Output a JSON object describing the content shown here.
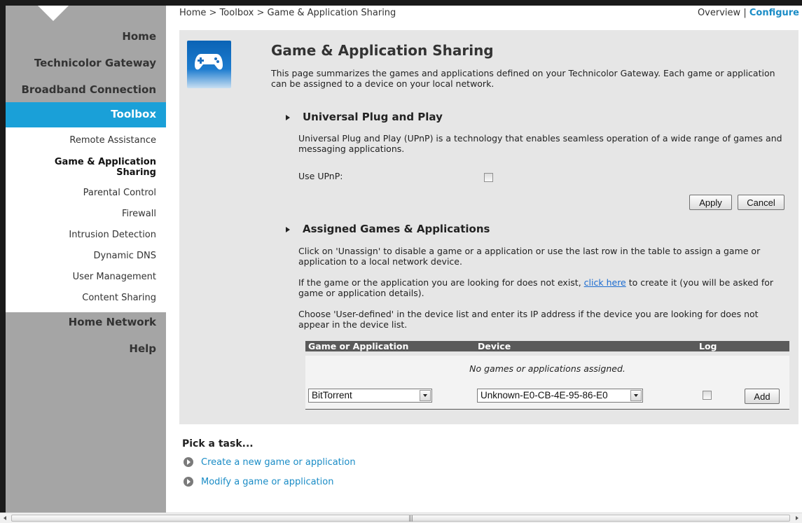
{
  "breadcrumb": [
    "Home",
    "Toolbox",
    "Game & Application Sharing"
  ],
  "breadcrumb_sep": ">",
  "view_links": {
    "overview": "Overview",
    "sep": "|",
    "configure": "Configure"
  },
  "sidebar": {
    "main_items": [
      "Home",
      "Technicolor Gateway",
      "Broadband Connection"
    ],
    "active": "Toolbox",
    "sub_items": [
      "Remote Assistance",
      "Game & Application Sharing",
      "Parental Control",
      "Firewall",
      "Intrusion Detection",
      "Dynamic DNS",
      "User Management",
      "Content Sharing"
    ],
    "current_sub": [
      "Game & Application",
      "Sharing"
    ],
    "bottom_items": [
      "Home Network",
      "Help"
    ]
  },
  "page": {
    "title": "Game & Application Sharing",
    "icon": "gamepad-icon",
    "description": "This page summarizes the games and applications defined on your Technicolor Gateway. Each game or application can be assigned to a device on your local network."
  },
  "upnp": {
    "heading": "Universal Plug and Play",
    "description": "Universal Plug and Play (UPnP) is a technology that enables seamless operation of a wide range of games and messaging applications.",
    "use_label": "Use UPnP:",
    "use_checked": false,
    "apply_label": "Apply",
    "cancel_label": "Cancel"
  },
  "assigned": {
    "heading": "Assigned Games & Applications",
    "para1": "Click on 'Unassign' to disable a game or a application or use the last row in the table to assign a game or application to a local network device.",
    "para2_before": "If the game or the application you are looking for does not exist, ",
    "para2_link": "click here",
    "para2_after": " to create it (you will be asked for game or application details).",
    "para3": "Choose 'User-defined' in the device list and enter its IP address if the device you are looking for does not appear in the device list.",
    "table": {
      "columns": [
        "Game or Application",
        "Device",
        "Log"
      ],
      "empty_text": "No games or applications assigned.",
      "new_row": {
        "game": "BitTorrent",
        "device": "Unknown-E0-CB-4E-95-86-E0",
        "log": false,
        "add_label": "Add"
      }
    }
  },
  "tasks": {
    "title": "Pick a task...",
    "items": [
      "Create a new game or application",
      "Modify a game or application"
    ]
  },
  "colors": {
    "accent": "#1aa0d8",
    "sidebar": "#a5a5a5",
    "link": "#1a8cc6",
    "panel": "#e6e6e6"
  }
}
